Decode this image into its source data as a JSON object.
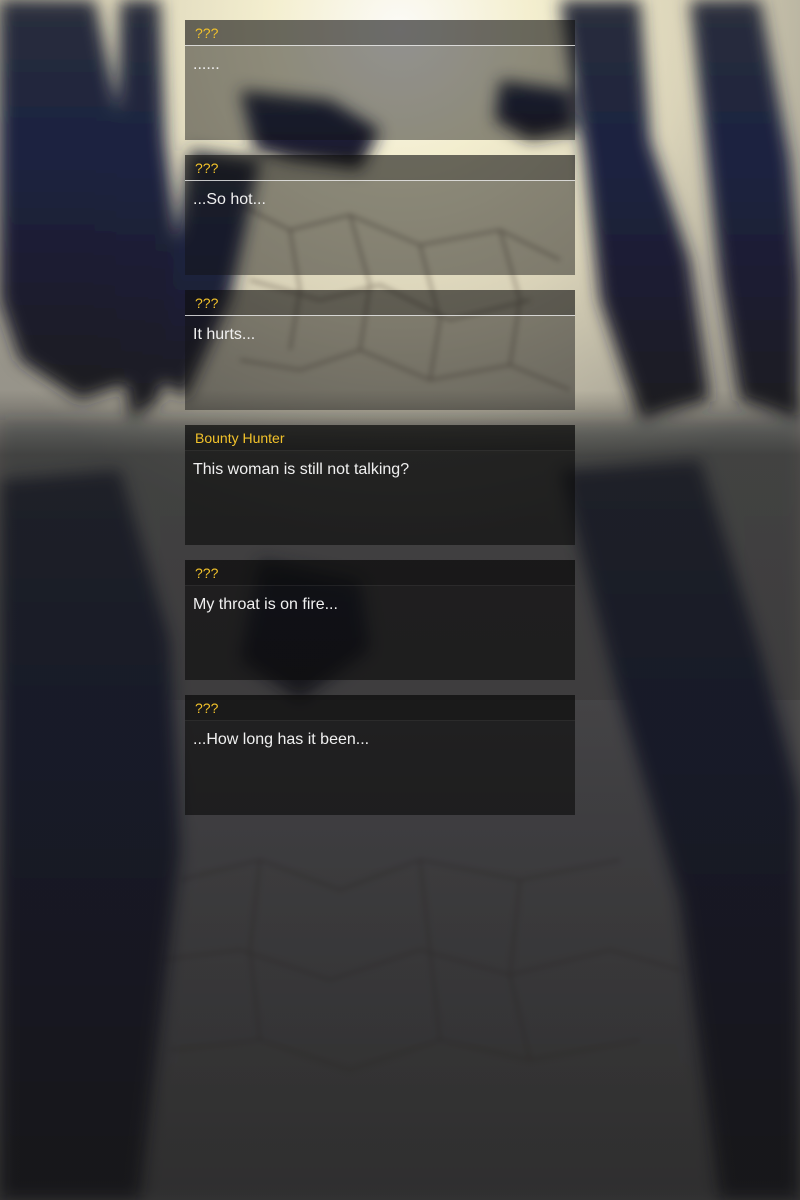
{
  "dialogue_log": [
    {
      "speaker": "???",
      "text": "......"
    },
    {
      "speaker": "???",
      "text": "...So hot..."
    },
    {
      "speaker": "???",
      "text": "It hurts..."
    },
    {
      "speaker": "Bounty Hunter",
      "text": "This woman is still not talking?"
    },
    {
      "speaker": "???",
      "text": "My throat is on fire..."
    },
    {
      "speaker": "???",
      "text": "...How long has it been..."
    }
  ],
  "colors": {
    "speaker_name": "#f2c22a",
    "dialogue_text": "#f0f0f0"
  }
}
